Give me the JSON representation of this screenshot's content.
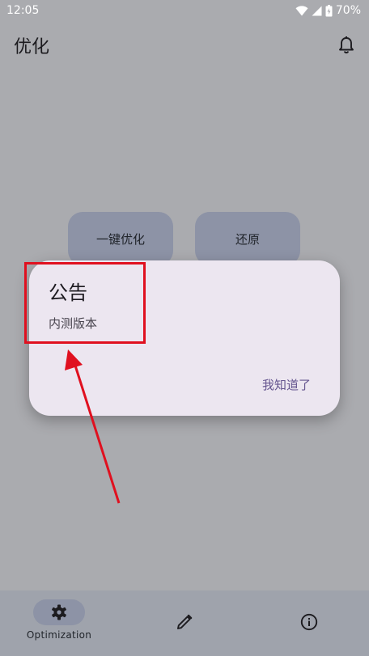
{
  "status_bar": {
    "time": "12:05",
    "battery": "70%",
    "icons": [
      "wifi-icon",
      "signal-icon",
      "battery-icon"
    ]
  },
  "app_bar": {
    "title": "优化",
    "action_icon": "bell-icon"
  },
  "actions": {
    "optimize_label": "一键优化",
    "restore_label": "还原"
  },
  "dialog": {
    "title": "公告",
    "body": "内测版本",
    "confirm_label": "我知道了"
  },
  "bottom_nav": {
    "items": [
      {
        "label": "Optimization",
        "icon": "gear-icon",
        "selected": true
      },
      {
        "label": "",
        "icon": "pencil-icon",
        "selected": false
      },
      {
        "label": "",
        "icon": "info-icon",
        "selected": false
      }
    ]
  },
  "colors": {
    "scrim_background": "#aaabaf",
    "dialog_surface": "#ece6f0",
    "accent_text": "#65558f",
    "annotation": "#e0101f"
  }
}
